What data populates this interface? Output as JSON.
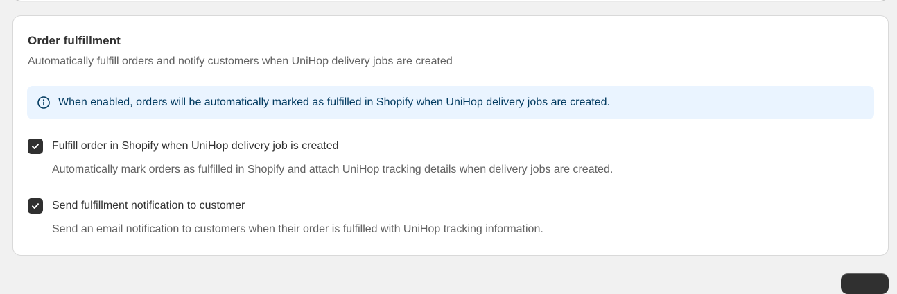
{
  "section": {
    "title": "Order fulfillment",
    "subtitle": "Automatically fulfill orders and notify customers when UniHop delivery jobs are created"
  },
  "banner": {
    "icon": "info-icon",
    "text": "When enabled, orders will be automatically marked as fulfilled in Shopify when UniHop delivery jobs are created."
  },
  "options": [
    {
      "label": "Fulfill order in Shopify when UniHop delivery job is created",
      "help": "Automatically mark orders as fulfilled in Shopify and attach UniHop tracking details when delivery jobs are created.",
      "checked": true
    },
    {
      "label": "Send fulfillment notification to customer",
      "help": "Send an email notification to customers when their order is fulfilled with UniHop tracking information.",
      "checked": true
    }
  ],
  "colors": {
    "background": "#f1f1f1",
    "card": "#ffffff",
    "banner_bg": "#eaf4ff",
    "banner_text": "#00395f",
    "checkbox": "#303030"
  }
}
